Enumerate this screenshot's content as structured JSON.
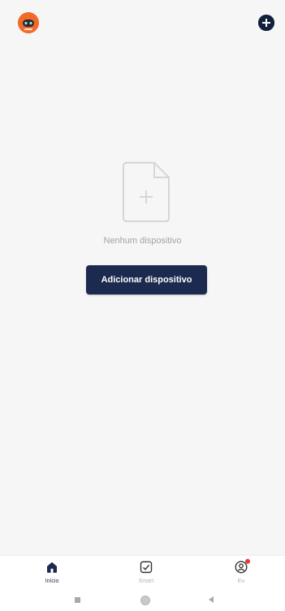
{
  "empty_state": {
    "message": "Nenhum dispositivo",
    "button_label": "Adicionar dispositivo"
  },
  "tabs": [
    {
      "label": "Início",
      "icon": "home-icon",
      "active": true
    },
    {
      "label": "Smart",
      "icon": "checkbox-icon",
      "active": false
    },
    {
      "label": "Eu",
      "icon": "user-icon",
      "active": false,
      "has_notification": true
    }
  ],
  "top_bar": {
    "avatar_icon": "robot-avatar-icon",
    "add_icon": "plus-circle-icon"
  },
  "colors": {
    "accent": "#1b2a4e",
    "avatar": "#f26a2a",
    "notification": "#e53935",
    "background": "#f6f6f6"
  }
}
